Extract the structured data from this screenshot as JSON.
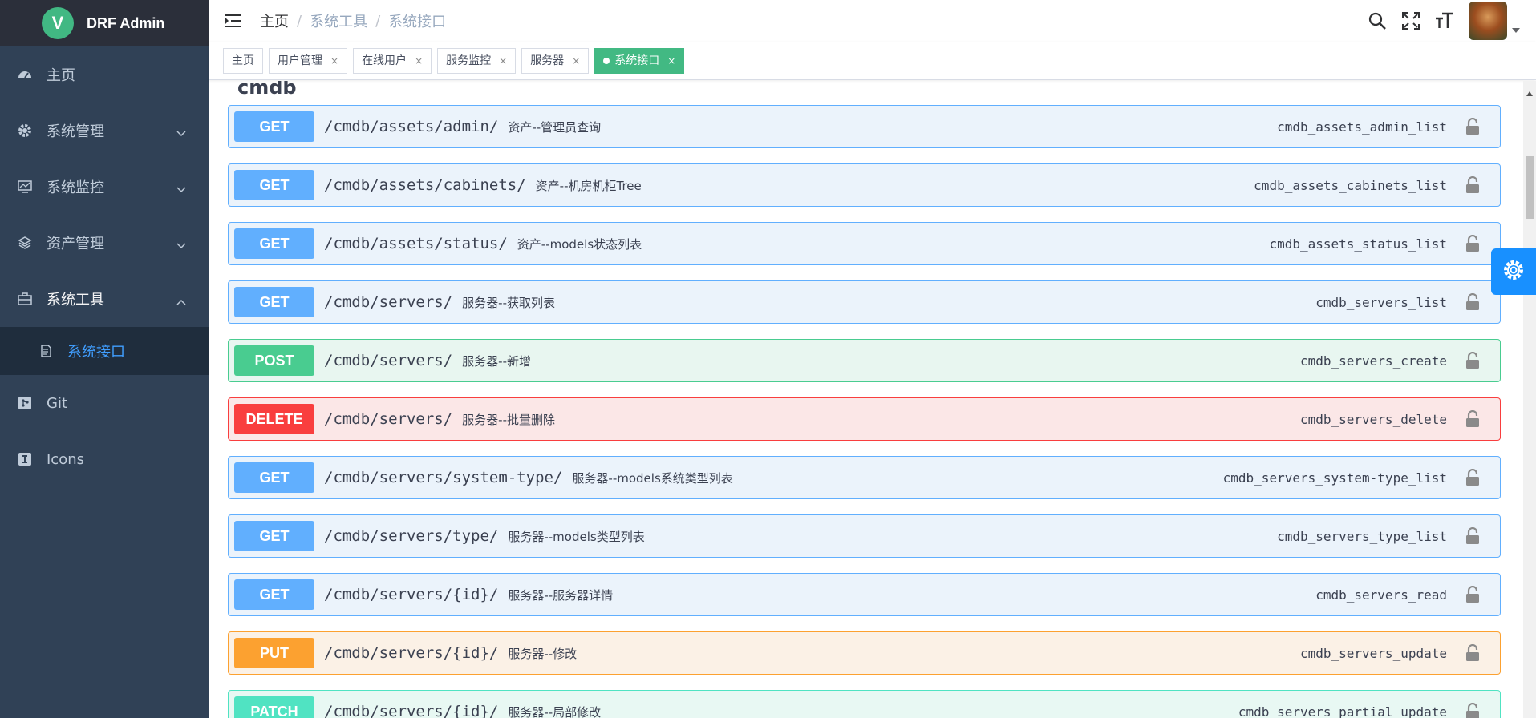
{
  "app": {
    "logo_letter": "V",
    "title": "DRF Admin"
  },
  "sidebar": {
    "items": [
      {
        "label": "主页",
        "icon": "dashboard-icon"
      },
      {
        "label": "系统管理",
        "icon": "gear-icon"
      },
      {
        "label": "系统监控",
        "icon": "monitor-icon"
      },
      {
        "label": "资产管理",
        "icon": "layers-icon"
      },
      {
        "label": "系统工具",
        "icon": "toolbox-icon"
      },
      {
        "label": "Git",
        "icon": "git-icon"
      },
      {
        "label": "Icons",
        "icon": "icons-icon"
      }
    ],
    "sub_items": [
      {
        "label": "系统接口",
        "icon": "document-icon"
      }
    ]
  },
  "breadcrumb": [
    {
      "label": "主页"
    },
    {
      "label": "系统工具"
    },
    {
      "label": "系统接口"
    }
  ],
  "tags": [
    {
      "label": "主页",
      "closable": false
    },
    {
      "label": "用户管理",
      "closable": true
    },
    {
      "label": "在线用户",
      "closable": true
    },
    {
      "label": "服务监控",
      "closable": true
    },
    {
      "label": "服务器",
      "closable": true
    },
    {
      "label": "系统接口",
      "closable": true,
      "active": true
    }
  ],
  "close_glyph": "×",
  "api": {
    "section_title": "cmdb",
    "operations": [
      {
        "method": "GET",
        "path": "/cmdb/assets/admin/",
        "summary": "资产--管理员查询",
        "operation_id": "cmdb_assets_admin_list"
      },
      {
        "method": "GET",
        "path": "/cmdb/assets/cabinets/",
        "summary": "资产--机房机柜Tree",
        "operation_id": "cmdb_assets_cabinets_list"
      },
      {
        "method": "GET",
        "path": "/cmdb/assets/status/",
        "summary": "资产--models状态列表",
        "operation_id": "cmdb_assets_status_list"
      },
      {
        "method": "GET",
        "path": "/cmdb/servers/",
        "summary": "服务器--获取列表",
        "operation_id": "cmdb_servers_list"
      },
      {
        "method": "POST",
        "path": "/cmdb/servers/",
        "summary": "服务器--新增",
        "operation_id": "cmdb_servers_create"
      },
      {
        "method": "DELETE",
        "path": "/cmdb/servers/",
        "summary": "服务器--批量删除",
        "operation_id": "cmdb_servers_delete"
      },
      {
        "method": "GET",
        "path": "/cmdb/servers/system-type/",
        "summary": "服务器--models系统类型列表",
        "operation_id": "cmdb_servers_system-type_list"
      },
      {
        "method": "GET",
        "path": "/cmdb/servers/type/",
        "summary": "服务器--models类型列表",
        "operation_id": "cmdb_servers_type_list"
      },
      {
        "method": "GET",
        "path": "/cmdb/servers/{id}/",
        "summary": "服务器--服务器详情",
        "operation_id": "cmdb_servers_read"
      },
      {
        "method": "PUT",
        "path": "/cmdb/servers/{id}/",
        "summary": "服务器--修改",
        "operation_id": "cmdb_servers_update"
      },
      {
        "method": "PATCH",
        "path": "/cmdb/servers/{id}/",
        "summary": "服务器--局部修改",
        "operation_id": "cmdb_servers_partial_update"
      }
    ]
  },
  "colors": {
    "sidebar_bg": "#304156",
    "active_tag": "#42b983",
    "get": "#61affe",
    "post": "#49cc90",
    "delete": "#f93e3e",
    "put": "#fca130",
    "patch": "#50e3c2",
    "settings": "#1890ff"
  }
}
